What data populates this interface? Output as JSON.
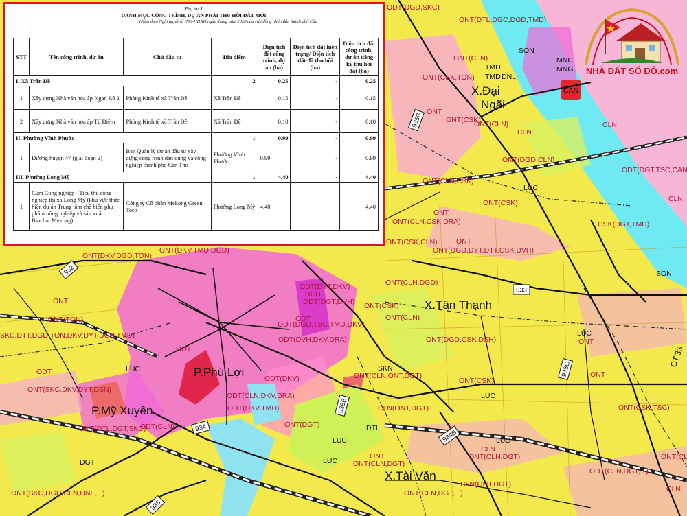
{
  "table_panel": {
    "title_line1": "Phụ lục I",
    "title_line2": "DANH MỤC CÔNG TRÌNH, DỰ ÁN PHẢI THU HỒI ĐẤT MỚI",
    "title_line3": "(Kèm theo Nghị quyết số /NQ-HĐND ngày tháng năm 2026 của Hội đồng nhân dân thành phố Cần",
    "headers": [
      "STT",
      "Tên công trình, dự án",
      "Chủ đầu tư",
      "Địa điểm",
      "Diện tích đất công trình, dự án (ha)",
      "Diện tích đất hiện trạng/ Diện tích đất đã thu hồi (ha)",
      "Diện tích đất công trình, dự án đăng ký thu hồi đất (ha)"
    ],
    "sections": [
      {
        "name": "I. Xã Trần Đề",
        "count": "2",
        "area": "0.25",
        "recovered": "-",
        "register": "0.25",
        "rows": [
          {
            "stt": "1",
            "name": "Xây dựng Nhà văn hóa ấp Ngan Rô 2",
            "owner": "Phòng Kinh tế xã Trần Đề",
            "place": "Xã Trần Đề",
            "area": "0.15",
            "recovered": "-",
            "register": "0.15"
          },
          {
            "stt": "2",
            "name": "Xây dựng Nhà văn hóa ấp Tú Điềm",
            "owner": "Phòng Kinh tế xã Trần Đề",
            "place": "Xã Trần Đề",
            "area": "0.10",
            "recovered": "-",
            "register": "0.10"
          }
        ]
      },
      {
        "name": "II. Phường Vĩnh Phước",
        "count": "1",
        "area": "0.99",
        "recovered": "-",
        "register": "0.99",
        "rows": [
          {
            "stt": "1",
            "name": "Đường huyện 47 (giai đoạn 2)",
            "owner": "Ban Quản lý dự án đầu tư xây dựng công trình dân dụng và công nghiệp thành phố Cần Thơ",
            "place": "Phường Vĩnh Phước",
            "area": "0.99",
            "recovered": "-",
            "register": "0.99"
          }
        ]
      },
      {
        "name": "III. Phường Long Mỹ",
        "count": "1",
        "area": "4.40",
        "recovered": "-",
        "register": "4.40",
        "rows": [
          {
            "stt": "1",
            "name": "Cụm Công nghiệp - Tiểu thủ công nghiệp thị xã Long Mỹ (khu vực thực hiện dự án Trung tâm chế biến phụ phẩm nông nghiệp và sản xuất Biochar Mekong)",
            "owner": "Công ty Cổ phần Mekong Green Tech",
            "place": "Phường Long Mỹ",
            "area": "4.40",
            "recovered": "-",
            "register": "4.40"
          }
        ]
      }
    ]
  },
  "logo": {
    "brand": "NHÀ ĐẤT SỔ ĐỎ.com"
  },
  "map": {
    "place_names": [
      "X.Đại",
      "Ngãi",
      "X.Tân Thạnh",
      "P.Phú Lợi",
      "P.Mỹ Xuyên",
      "X.Tài Văn"
    ],
    "road_numbers": [
      "935B",
      "932",
      "933",
      "934",
      "934B",
      "935B",
      "935C",
      "936",
      "CT.33"
    ],
    "landuse_labels": [
      "ODT(DGD,SKC)",
      "ONT(DTL,DGC,DGD,TMD)",
      "SON",
      "DNL",
      "TMD",
      "ONT(CLN)",
      "ONT(CSK,TON)",
      "MNC",
      "MNG",
      "CAN",
      "TMD",
      "ONT",
      "CLN",
      "ONT(CSK)",
      "ONT(CLN)",
      "CLN",
      "ONT(DGD,CLN)",
      "ODT(DGT,TSC,CAN,T",
      "ONT(CLN,CSK)",
      "LUC",
      "ONT(CSK)",
      "CLN",
      "ONT",
      "CSK(DGT,TMD)",
      "ONT(CLN,CSK,DRA)",
      "ONT(CSK,CLN)",
      "ONT",
      "ONT(DGD,DYT,DTT,CSK,DVH)",
      "SON",
      "ONT(CLN,DGD)",
      "ONT(DKV,DGD,TON)",
      "ONT(DKV,TMD,DGD)",
      "ONT",
      "ONT(TON)",
      "ODT(DYT,DKV)",
      "DCH",
      "ODT(DGT,DVH)",
      "ONT(CSK)",
      "ONT(CLN)",
      "SKC,DTT,DGD,TON,DKV,DYT,DCH,TMD)",
      "ODT",
      "ODT(DGD,TSC,TMD,DKV)",
      "ONT(DGD,CSK,DSH)",
      "ODT(DVH,DKV,DRA)",
      "LUC",
      "ONT",
      "ODT",
      "LUC",
      "ONT(SKC,DKV,DYT,DSN)",
      "ODT",
      "ODT(DKV)",
      "SKN",
      "ONT(CLN,ONT,DGT)",
      "ONT(CSK)",
      "ODT(CLN,DKV,DRA)",
      "ONT",
      "LUC",
      "ONT(CSK,TSC)",
      "CLN(ONT,DGT)",
      "ODT(CLN)",
      "ONT(DTL,DGT,SKC)",
      "ODT(DKV,TMD)",
      "ONT(DGT)",
      "DTL",
      "DGT",
      "LUC",
      "LUC",
      "CLN",
      "ONT(CLN,DGT)",
      "ONT(CLN,DGT)",
      "ONT(CLN,DGT)",
      "ONT",
      "LUC",
      "ONT(SKC,DGD,CLN,DNL,...)",
      "CLN(ONT,DGT)",
      "ODT(CLN,DGT,...)",
      "ONT(CLN,DGT,...)",
      "CLN"
    ]
  }
}
